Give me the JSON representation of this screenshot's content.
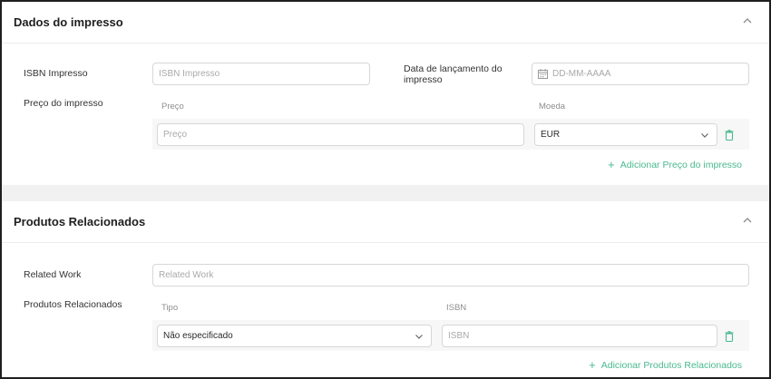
{
  "print_section": {
    "title": "Dados do impresso",
    "isbn_label": "ISBN Impresso",
    "isbn_placeholder": "ISBN Impresso",
    "release_date_label_line1": "Data de lançamento do",
    "release_date_label_line2": "impresso",
    "release_date_placeholder": "DD-MM-AAAA",
    "price_label": "Preço do impresso",
    "price_column": "Preço",
    "currency_column": "Moeda",
    "price_placeholder": "Preço",
    "currency_value": "EUR",
    "add_price_link": "Adicionar Preço do impresso"
  },
  "related_section": {
    "title": "Produtos Relacionados",
    "related_work_label": "Related Work",
    "related_work_placeholder": "Related Work",
    "related_products_label": "Produtos Relacionados",
    "type_column": "Tipo",
    "isbn_column": "ISBN",
    "type_value": "Não especificado",
    "isbn_placeholder": "ISBN",
    "add_related_link": "Adicionar Produtos Relacionados"
  },
  "icons": {
    "collapse": "chevron-up-icon",
    "dropdown": "chevron-down-icon",
    "delete": "trash-icon",
    "calendar": "calendar-icon",
    "add": "plus-icon"
  },
  "colors": {
    "accent": "#49b98f",
    "divider": "#f1f1f1",
    "border": "#d7d7d7"
  }
}
